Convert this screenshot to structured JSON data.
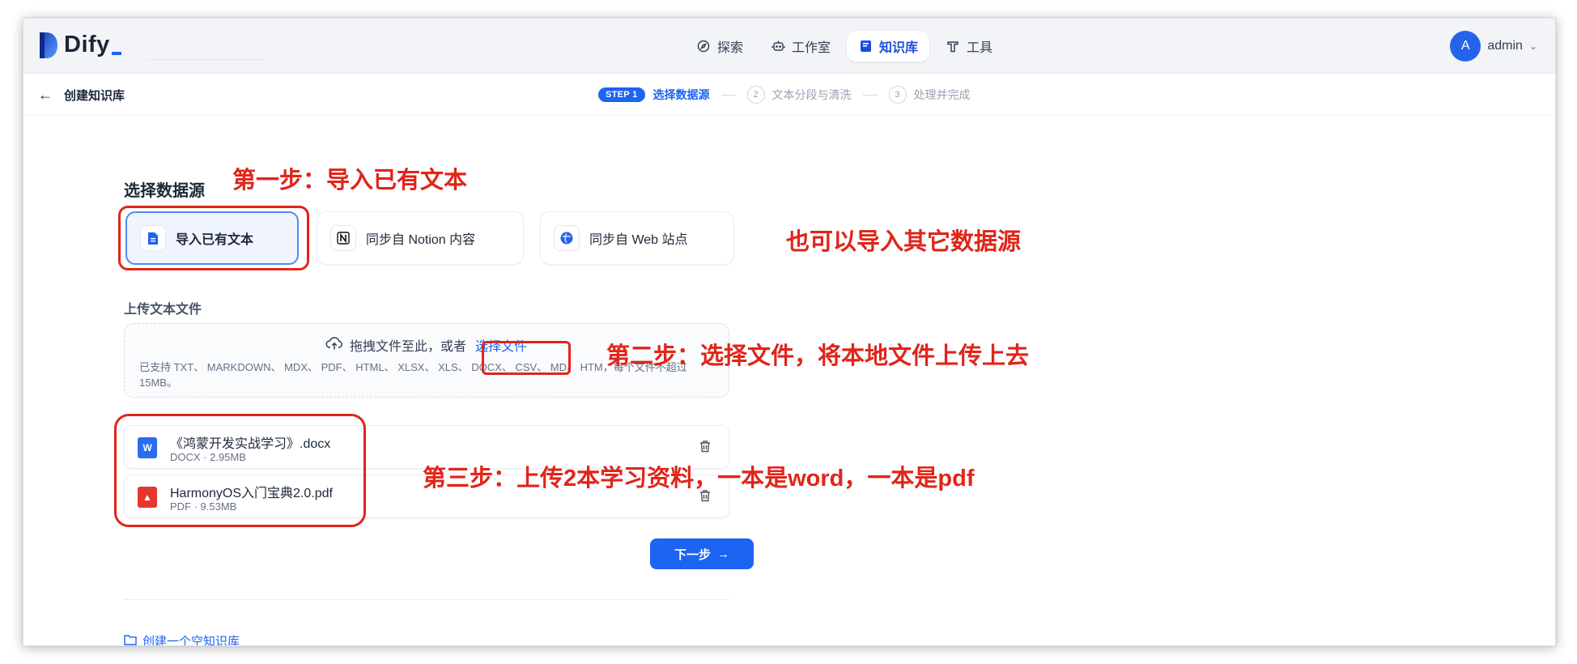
{
  "app": {
    "logo_text": "Dify",
    "brand_color": "#1c64f2",
    "annotation_color": "#e0251a"
  },
  "nav": {
    "items": [
      {
        "label": "探索",
        "icon": "explore-icon",
        "active": false
      },
      {
        "label": "工作室",
        "icon": "robot-icon",
        "active": false
      },
      {
        "label": "知识库",
        "icon": "book-icon",
        "active": true
      },
      {
        "label": "工具",
        "icon": "tool-icon",
        "active": false
      }
    ]
  },
  "user": {
    "avatar_letter": "A",
    "name": "admin"
  },
  "subheader": {
    "back_title": "创建知识库"
  },
  "steps": {
    "active_badge": "STEP 1",
    "active_label": "选择数据源",
    "step2_num": "2",
    "step2_label": "文本分段与清洗",
    "step3_num": "3",
    "step3_label": "处理并完成"
  },
  "main": {
    "section_title": "选择数据源",
    "sources": [
      {
        "label": "导入已有文本",
        "icon": "file-text-icon",
        "selected": true
      },
      {
        "label": "同步自 Notion 内容",
        "icon": "notion-icon",
        "selected": false
      },
      {
        "label": "同步自 Web 站点",
        "icon": "web-icon",
        "selected": false
      }
    ],
    "upload_label": "上传文本文件",
    "dropzone": {
      "prompt": "拖拽文件至此，或者",
      "link": "选择文件",
      "hint": "已支持 TXT、 MARKDOWN、 MDX、 PDF、 HTML、 XLSX、 XLS、 DOCX、 CSV、 MD、 HTM，每个文件不超过 15MB。"
    },
    "files": [
      {
        "name": "《鸿蒙开发实战学习》.docx",
        "meta": "DOCX · 2.95MB",
        "type": "docx",
        "color": "#2b6cf3"
      },
      {
        "name": "HarmonyOS入门宝典2.0.pdf",
        "meta": "PDF · 9.53MB",
        "type": "pdf",
        "color": "#e5372f"
      }
    ],
    "next_button": "下一步",
    "create_empty": "创建一个空知识库"
  },
  "annotations": {
    "step1": "第一步：导入已有文本",
    "other_sources": "也可以导入其它数据源",
    "step2": "第二步：选择文件，将本地文件上传上去",
    "step3": "第三步：上传2本学习资料，一本是word，一本是pdf"
  }
}
